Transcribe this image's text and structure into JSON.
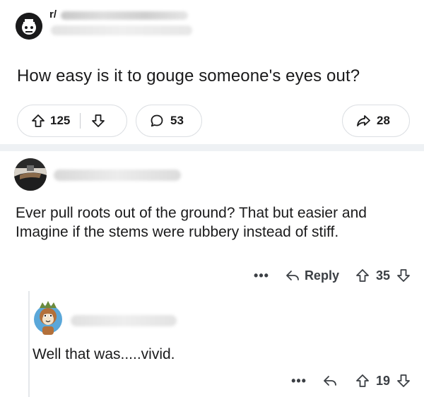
{
  "post": {
    "subreddit_prefix": "r/",
    "title": "How easy is it to gouge someone's eyes out?",
    "upvotes": "125",
    "comments": "53",
    "shares": "28"
  },
  "comments": [
    {
      "text": "Ever pull roots out of the ground? That but easier and Imagine if the stems were rubbery instead of stiff.",
      "more": "•••",
      "reply_label": "Reply",
      "score": "35"
    },
    {
      "text": "Well that was.....vivid.",
      "more": "•••",
      "score": "19"
    }
  ],
  "icons": {
    "upvote": "arrow-up-icon",
    "downvote": "arrow-down-icon",
    "comment": "speech-bubble-icon",
    "share": "share-arrow-icon",
    "reply": "reply-arrow-icon"
  },
  "colors": {
    "text": "#1a1a1b",
    "border": "#dcdfe3",
    "divider": "#eef1f4"
  }
}
